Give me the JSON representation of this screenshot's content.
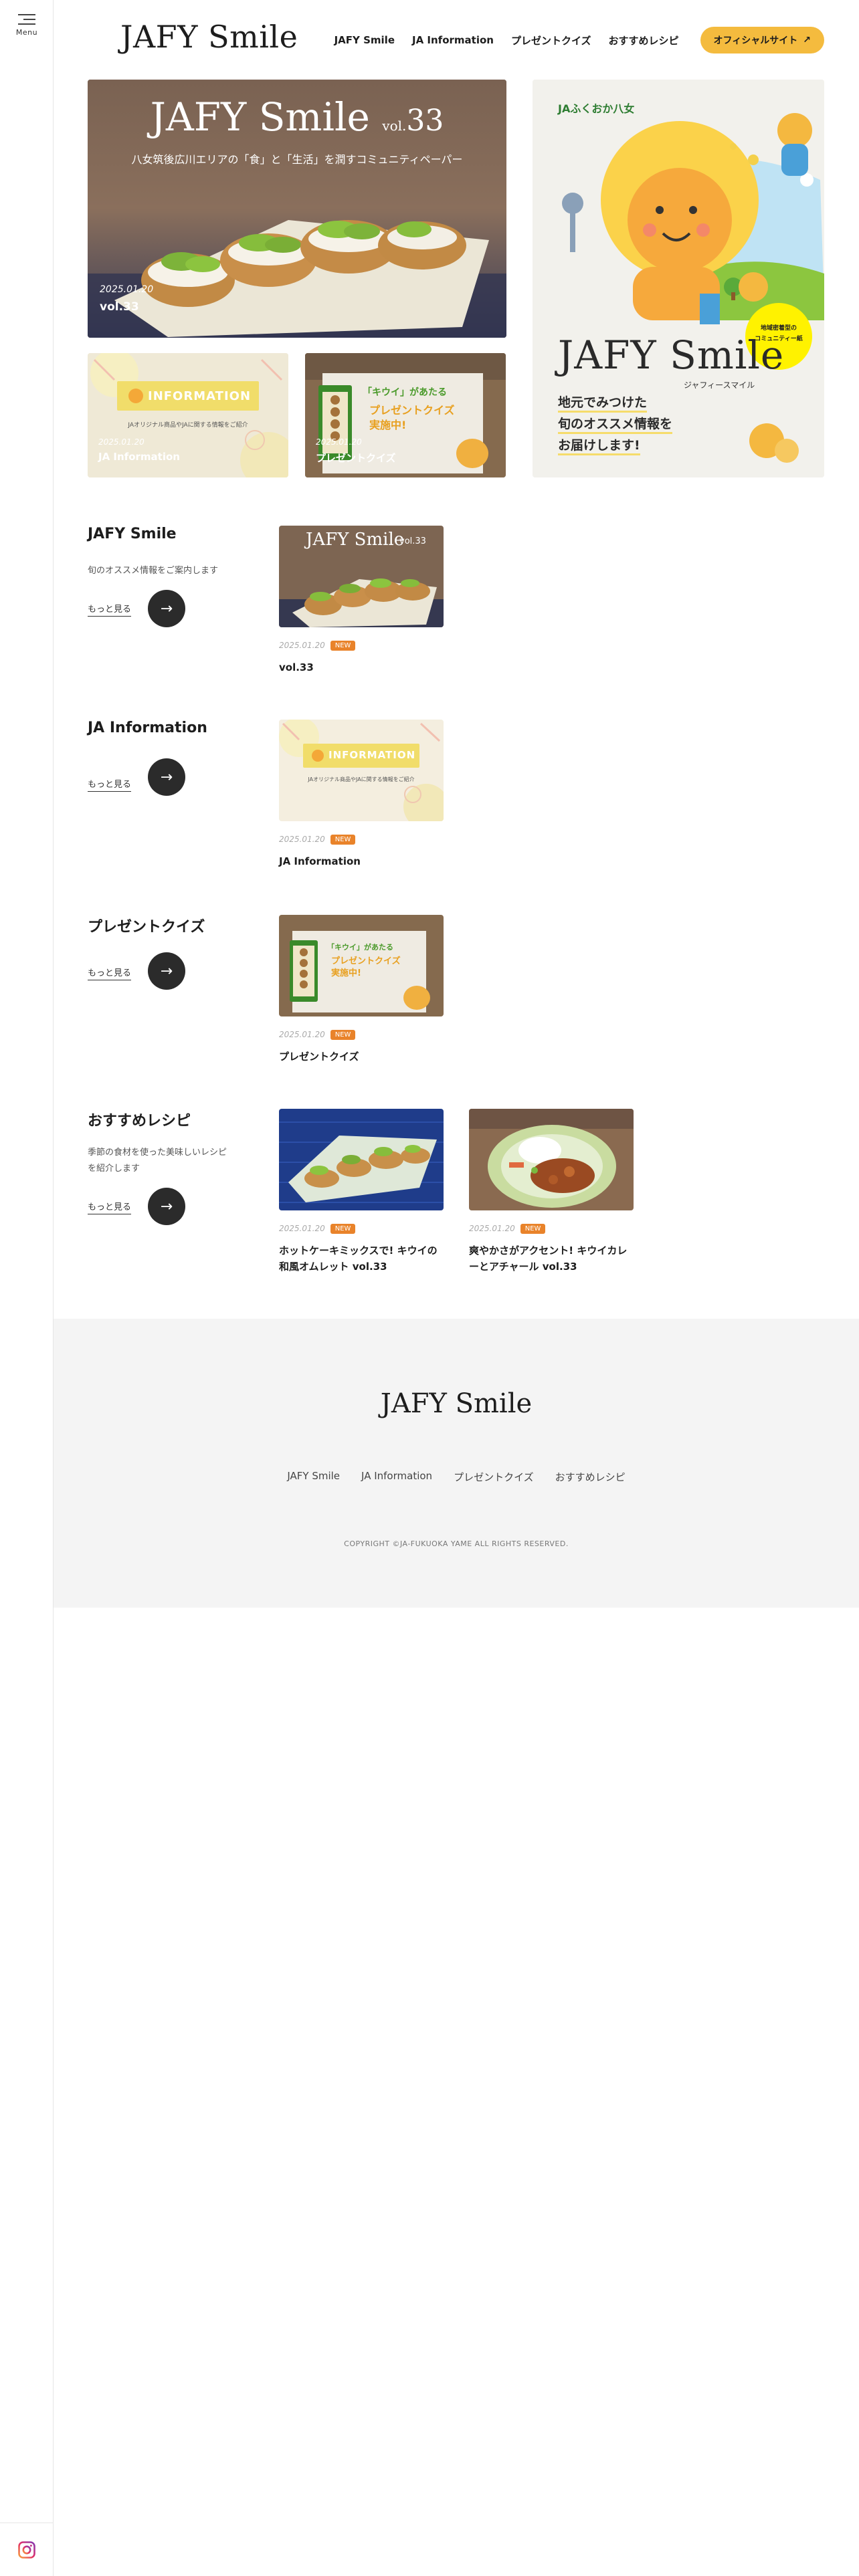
{
  "rail": {
    "menu_label": "Menu",
    "instagram_icon": "instagram-icon"
  },
  "header": {
    "logo": "JAFY Smile",
    "nav": [
      "JAFY Smile",
      "JA Information",
      "プレゼントクイズ",
      "おすすめレシピ"
    ],
    "official_label": "オフィシャルサイト",
    "official_icon": "arrow-up-right-icon"
  },
  "hero": {
    "main": {
      "logo": "JAFY Smile",
      "vol_prefix": "vol.",
      "vol_number": "33",
      "tagline": "八女筑後広川エリアの「食」と「生活」を潤すコミュニティペーパー",
      "date": "2025.01.20",
      "title": "vol.33"
    },
    "ja": {
      "banner": "INFORMATION",
      "subtitle": "JAオリジナル商品やJAに関する情報をご紹介",
      "date": "2025.01.20",
      "title": "JA Information"
    },
    "quiz": {
      "kiwi_label": "「キウイ」があたる",
      "quiz_line1": "プレゼントクイズ",
      "quiz_line2": "実施中!",
      "date": "2025.01.20",
      "title": "プレゼントクイズ"
    },
    "right": {
      "org": "JAふくおか八女",
      "logo": "JAFY Smile",
      "kana": "ジャフィースマイル",
      "bubble_line1": "地域密着型の",
      "bubble_line2": "コミュニティー紙",
      "line1": "地元でみつけた",
      "line2": "旬のオススメ情報を",
      "line3": "お届けします!"
    }
  },
  "sections": [
    {
      "title": "JAFY Smile",
      "desc": "旬のオススメ情報をご案内します",
      "more": "もっと見る",
      "cards": [
        {
          "date": "2025.01.20",
          "badge": "NEW",
          "title": "vol.33",
          "thumb_logo": "JAFY Smile",
          "thumb_vol": "vol.33"
        }
      ]
    },
    {
      "title": "JA Information",
      "desc": "",
      "more": "もっと見る",
      "cards": [
        {
          "date": "2025.01.20",
          "badge": "NEW",
          "title": "JA Information",
          "thumb_banner": "INFORMATION",
          "thumb_sub": "JAオリジナル商品やJAに関する情報をご紹介"
        }
      ]
    },
    {
      "title": "プレゼントクイズ",
      "desc": "",
      "more": "もっと見る",
      "cards": [
        {
          "date": "2025.01.20",
          "badge": "NEW",
          "title": "プレゼントクイズ",
          "thumb_line1": "「キウイ」があたる",
          "thumb_line2": "プレゼントクイズ",
          "thumb_line3": "実施中!"
        }
      ]
    },
    {
      "title": "おすすめレシピ",
      "desc": "季節の食材を使った美味しいレシピを紹介します",
      "more": "もっと見る",
      "cards": [
        {
          "date": "2025.01.20",
          "badge": "NEW",
          "title": "ホットケーキミックスで! キウイの和風オムレット vol.33"
        },
        {
          "date": "2025.01.20",
          "badge": "NEW",
          "title": "爽やかさがアクセント! キウイカレーとアチャール vol.33"
        }
      ]
    }
  ],
  "footer": {
    "logo": "JAFY Smile",
    "nav": [
      "JAFY Smile",
      "JA Information",
      "プレゼントクイズ",
      "おすすめレシピ"
    ],
    "copyright": "COPYRIGHT ©JA-FUKUOKA YAME ALL RIGHTS RESERVED."
  },
  "colors": {
    "accent": "#f4bb3e",
    "badge": "#e9832a",
    "dark_button": "#2b2b2b",
    "footer_bg": "#f4f4f4",
    "ja_green": "#2e7d32"
  }
}
